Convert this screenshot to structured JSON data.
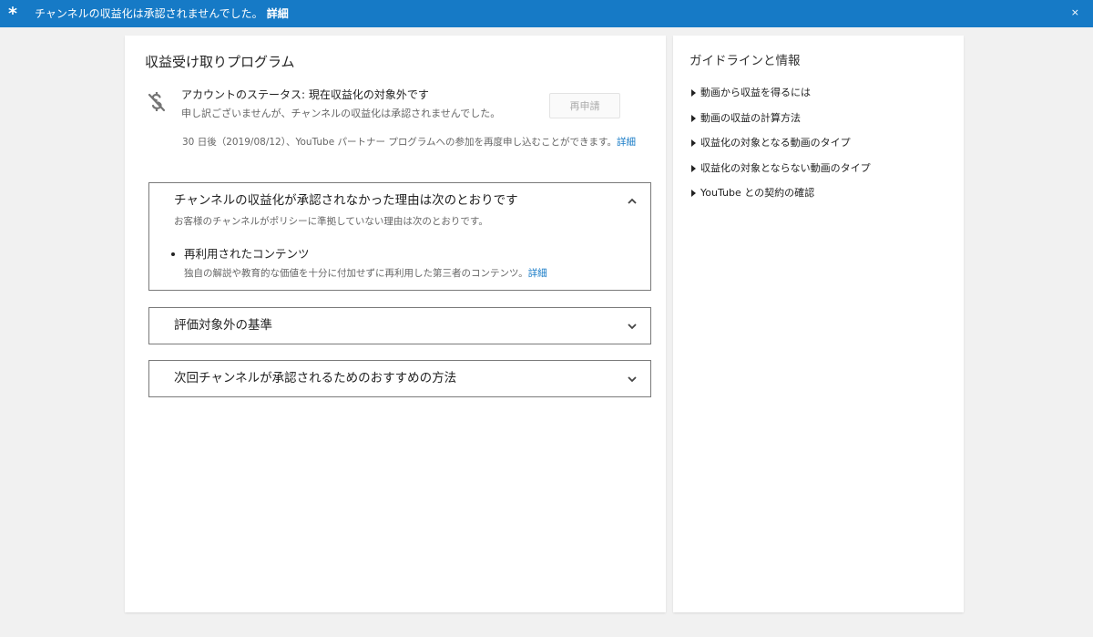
{
  "banner": {
    "message": "チャンネルの収益化は承認されませんでした。",
    "link": "詳細",
    "close": "×",
    "background": "#167ac6"
  },
  "main": {
    "title": "収益受け取りプログラム",
    "status": {
      "icon": "dollar-off-icon",
      "title": "アカウントのステータス: 現在収益化の対象外です",
      "description": "申し訳ございませんが、チャンネルの収益化は承認されませんでした。",
      "button": "再申請",
      "note": "30 日後（2019/08/12）、YouTube パートナー プログラムへの参加を再度申し込むことができます。",
      "note_link": "詳細"
    },
    "panels": [
      {
        "title": "チャンネルの収益化が承認されなかった理由は次のとおりです",
        "subtitle": "お客様のチャンネルがポリシーに準拠していない理由は次のとおりです。",
        "expanded": true,
        "reason": {
          "title": "再利用されたコンテンツ",
          "description": "独自の解説や教育的な価値を十分に付加せずに再利用した第三者のコンテンツ。",
          "link": "詳細"
        }
      },
      {
        "title": "評価対象外の基準",
        "expanded": false
      },
      {
        "title": "次回チャンネルが承認されるためのおすすめの方法",
        "expanded": false
      }
    ]
  },
  "sidebar": {
    "title": "ガイドラインと情報",
    "items": [
      "動画から収益を得るには",
      "動画の収益の計算方法",
      "収益化の対象となる動画のタイプ",
      "収益化の対象とならない動画のタイプ",
      "YouTube との契約の確認"
    ]
  },
  "colors": {
    "accent": "#167ac6",
    "page_background": "#f1f1f1"
  }
}
